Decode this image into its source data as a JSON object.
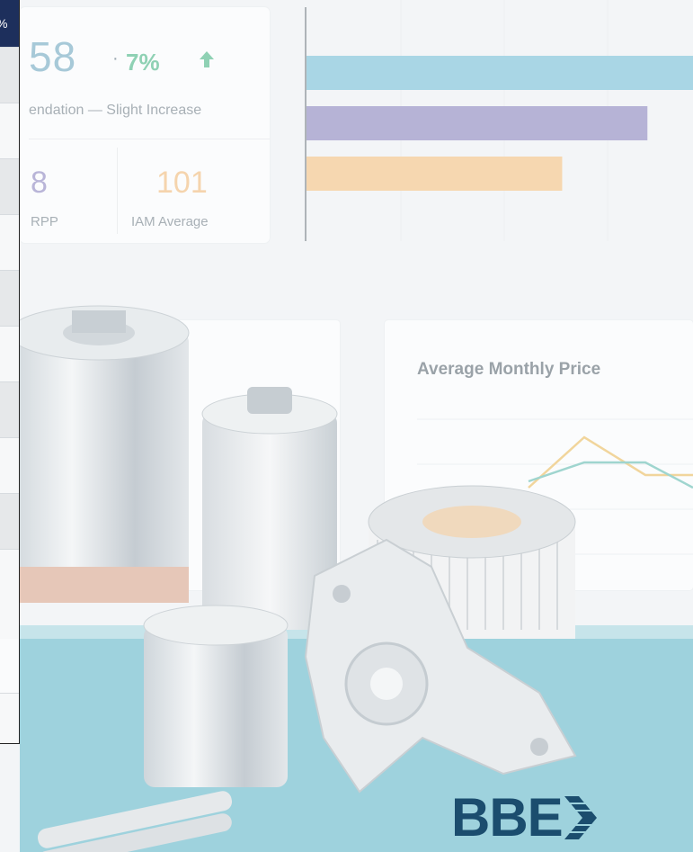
{
  "panel": {
    "header_text": "%",
    "rows": [
      {
        "shade": true
      },
      {
        "shade": false
      },
      {
        "shade": true
      },
      {
        "shade": false
      },
      {
        "shade": true
      },
      {
        "shade": false
      },
      {
        "shade": true
      },
      {
        "shade": false
      },
      {
        "shade": true
      },
      {
        "shade": false
      }
    ]
  },
  "kpi": {
    "main_value": "58",
    "separator": "·",
    "change": "7%",
    "change_icon": "arrow-up-icon",
    "subtitle": "endation — Slight Increase",
    "rpp_value": "8",
    "rpp_label": "RPP",
    "iam_value": "101",
    "iam_label": "IAM Average"
  },
  "bar_chart": {
    "chart_data": {
      "type": "bar",
      "orientation": "horizontal",
      "series_colors": [
        "#a9d6e5",
        "#b6b3d6",
        "#f6d7b0"
      ],
      "values": [
        100,
        88,
        66
      ],
      "grid": true
    }
  },
  "line_chart": {
    "title": "Average Monthly Price",
    "chart_data": {
      "type": "line",
      "series": [
        {
          "color": "#f1d59c",
          "values": [
            2,
            10,
            4,
            4
          ]
        },
        {
          "color": "#9fd5cf",
          "values": [
            3,
            6,
            6,
            2
          ]
        }
      ],
      "grid": true
    }
  },
  "logo": {
    "text": "BBE",
    "colors": {
      "primary": "#1b4d6e"
    }
  }
}
